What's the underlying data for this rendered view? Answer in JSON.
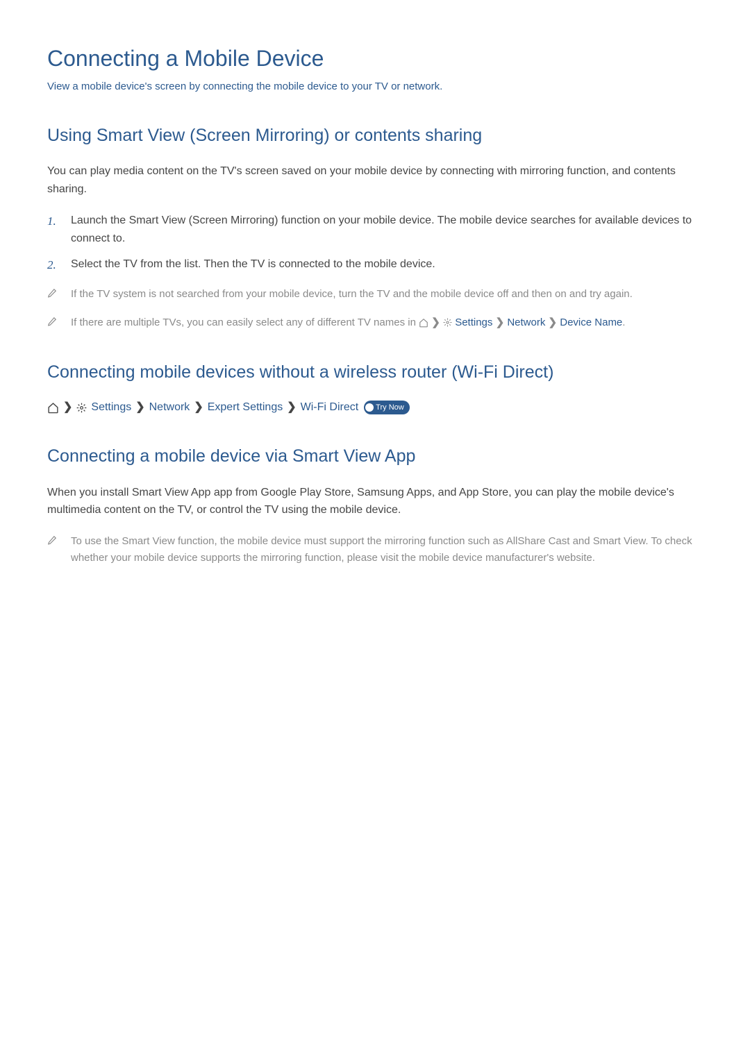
{
  "main": {
    "title": "Connecting a Mobile Device",
    "subtitle": "View a mobile device's screen by connecting the mobile device to your TV or network."
  },
  "section1": {
    "heading": "Using Smart View (Screen Mirroring) or contents sharing",
    "intro": "You can play media content on the TV's screen saved on your mobile device by connecting with mirroring function, and contents sharing.",
    "steps": [
      {
        "num": "1.",
        "text": "Launch the Smart View (Screen Mirroring) function on your mobile device. The mobile device searches for available devices to connect to."
      },
      {
        "num": "2.",
        "text": "Select the TV from the list. Then the TV is connected to the mobile device."
      }
    ],
    "notes": [
      {
        "text": "If the TV system is not searched from your mobile device, turn the TV and the mobile device off and then on and try again."
      },
      {
        "prefix": "If there are multiple TVs, you can easily select any of different TV names in ",
        "path": {
          "settings": "Settings",
          "network": "Network",
          "deviceName": "Device Name"
        },
        "suffix": "."
      }
    ]
  },
  "section2": {
    "heading": "Connecting mobile devices without a wireless router (Wi-Fi Direct)",
    "breadcrumb": {
      "settings": "Settings",
      "network": "Network",
      "expertSettings": "Expert Settings",
      "wifiDirect": "Wi-Fi Direct",
      "tryNow": "Try Now"
    }
  },
  "section3": {
    "heading": "Connecting a mobile device via Smart View App",
    "intro": "When you install Smart View App app from Google Play Store, Samsung Apps, and App Store, you can play the mobile device's multimedia content on the TV, or control the TV using the mobile device.",
    "note": "To use the Smart View function, the mobile device must support the mirroring function such as AllShare Cast and Smart View. To check whether your mobile device supports the mirroring function, please visit the mobile device manufacturer's website."
  }
}
